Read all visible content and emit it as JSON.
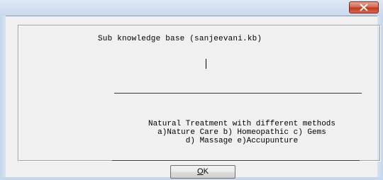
{
  "window": {
    "close_glyph": "✕"
  },
  "groupbox": {
    "title": "Sub knowledge base (sanjeevani.kb)",
    "description_lines": [
      "Natural Treatment with different methods",
      "a)Nature Care b) Homeopathic c) Gems",
      "d) Massage e)Accupunture"
    ]
  },
  "buttons": {
    "ok_label": "OK",
    "ok_mnemonic": "O",
    "ok_rest": "K"
  },
  "colors": {
    "close_button": "#c0391d",
    "frame": "#c9d9ec",
    "client": "#f0f0f0"
  }
}
